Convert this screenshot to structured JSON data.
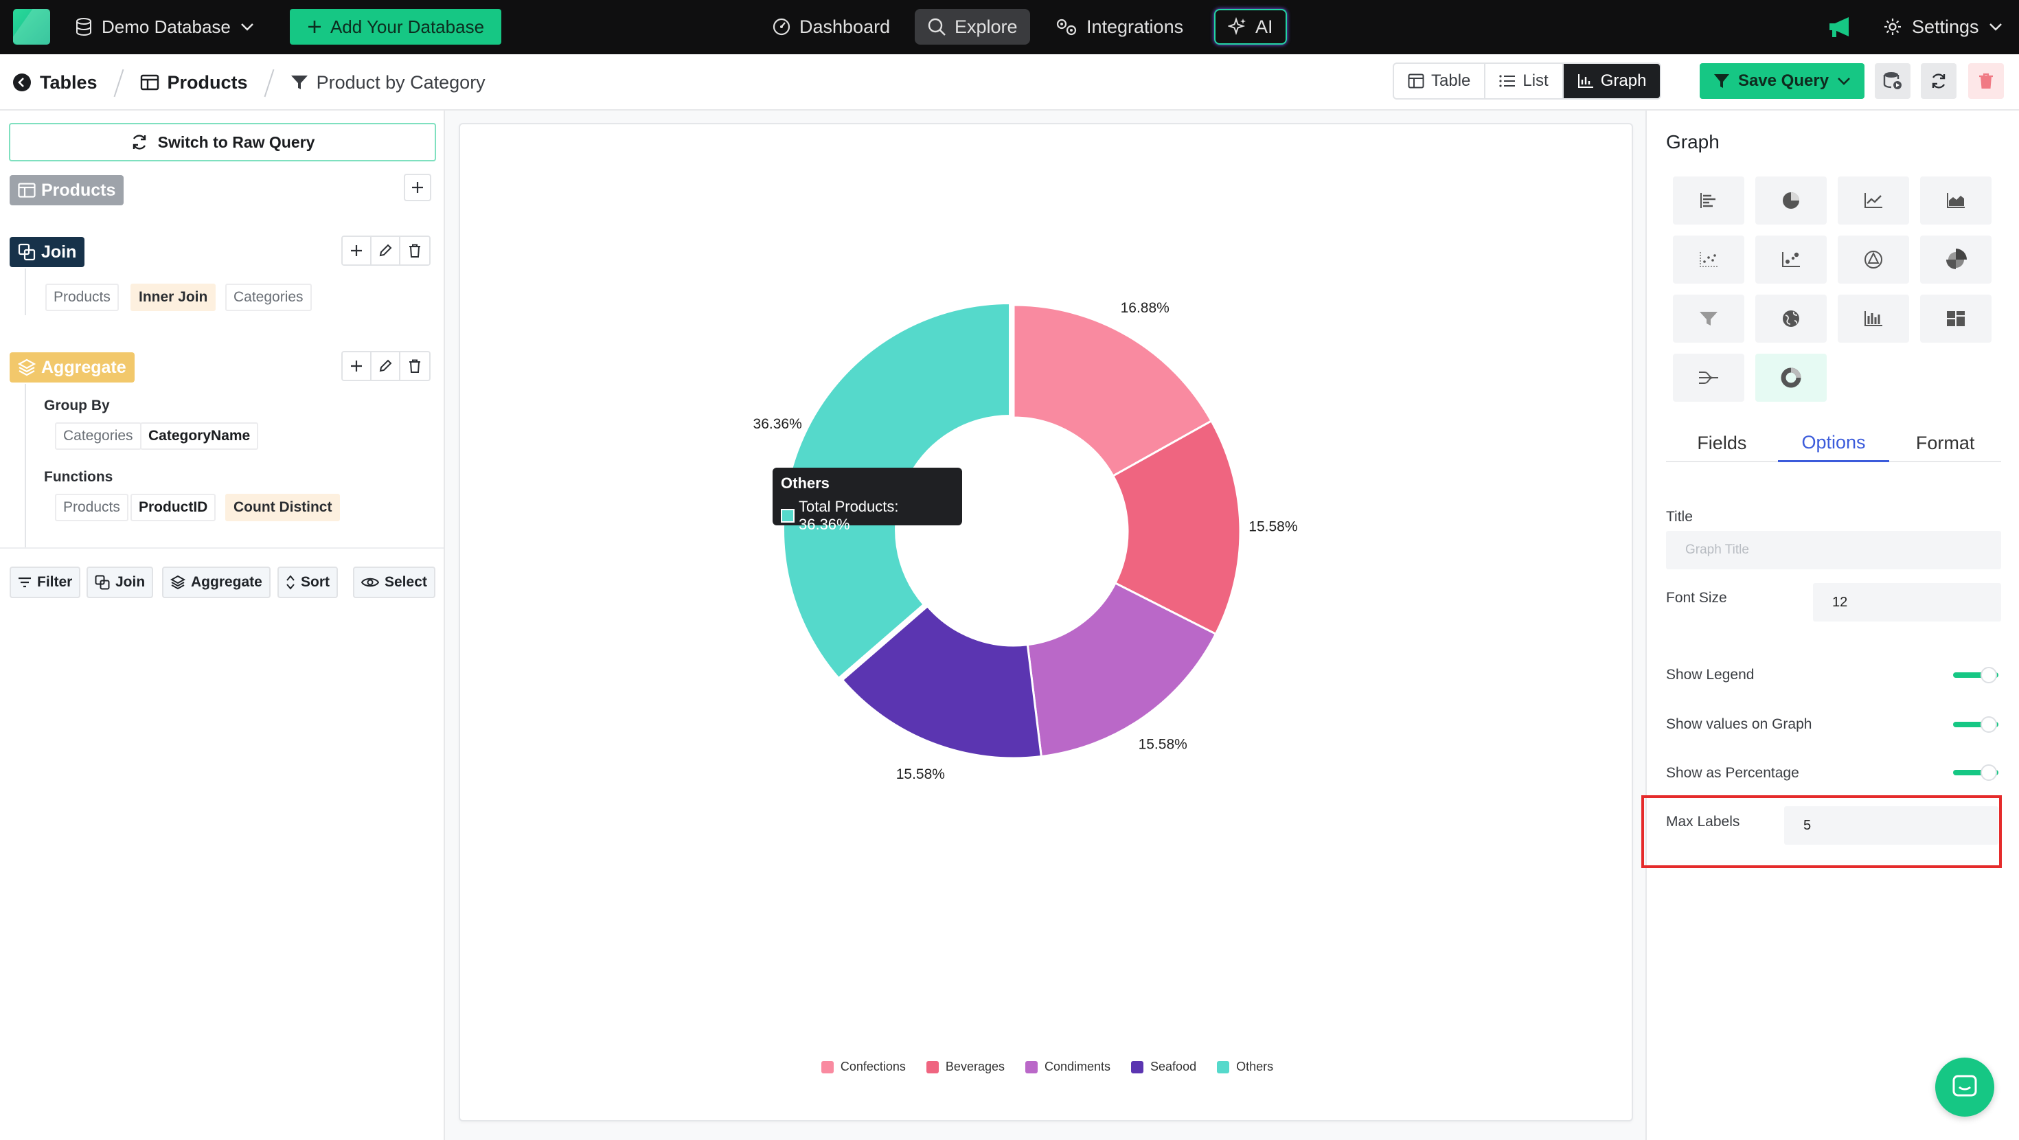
{
  "topnav": {
    "database_label": "Demo Database",
    "add_database_label": "Add Your Database",
    "dashboard_label": "Dashboard",
    "explore_label": "Explore",
    "integrations_label": "Integrations",
    "ai_label": "AI",
    "settings_label": "Settings"
  },
  "breadcrumb": {
    "tables": "Tables",
    "products": "Products",
    "query": "Product by Category"
  },
  "view_toggle": {
    "table": "Table",
    "list": "List",
    "graph": "Graph",
    "active": "Graph"
  },
  "toolbar": {
    "save_query_label": "Save Query"
  },
  "left_panel": {
    "switch_raw_label": "Switch to Raw Query",
    "source_table": "Products",
    "join": {
      "label": "Join",
      "left": "Products",
      "type": "Inner Join",
      "right": "Categories"
    },
    "aggregate": {
      "label": "Aggregate",
      "group_by_label": "Group By",
      "group_by_table": "Categories",
      "group_by_field": "CategoryName",
      "functions_label": "Functions",
      "func_table": "Products",
      "func_field": "ProductID",
      "func_name": "Count Distinct"
    },
    "actions": {
      "filter": "Filter",
      "join": "Join",
      "aggregate": "Aggregate",
      "sort": "Sort",
      "select": "Select"
    }
  },
  "chart_data": {
    "type": "pie",
    "variant": "donut",
    "title": "",
    "categories": [
      "Confections",
      "Beverages",
      "Condiments",
      "Seafood",
      "Others"
    ],
    "values": [
      16.88,
      15.58,
      15.58,
      15.58,
      36.36
    ],
    "value_labels": [
      "16.88%",
      "15.58%",
      "15.58%",
      "15.58%",
      "36.36%"
    ],
    "colors": [
      "#f98aa0",
      "#ef6580",
      "#ba68c8",
      "#5b35b1",
      "#55d9cb"
    ],
    "legend": "bottom-center",
    "highlighted_slice": "Others"
  },
  "tooltip": {
    "title": "Others",
    "row": "Total Products: 36.36%"
  },
  "right_panel": {
    "title": "Graph",
    "chart_type_icons": [
      "bar-chart-icon",
      "pie-chart-icon",
      "line-chart-icon",
      "area-chart-icon",
      "scatter-chart-icon",
      "bubble-chart-icon",
      "radar-chart-icon",
      "polar-area-icon",
      "funnel-chart-icon",
      "map-chart-icon",
      "histogram-icon",
      "treemap-icon",
      "sankey-chart-icon",
      "donut-chart-icon"
    ],
    "active_chart_type": "donut-chart-icon",
    "tabs": [
      "Fields",
      "Options",
      "Format"
    ],
    "active_tab": "Options",
    "options": {
      "title_label": "Title",
      "title_placeholder": "Graph Title",
      "font_size_label": "Font Size",
      "font_size_value": "12",
      "show_legend_label": "Show Legend",
      "show_legend": true,
      "show_values_label": "Show values on Graph",
      "show_values": true,
      "show_percentage_label": "Show as Percentage",
      "show_percentage": true,
      "max_labels_label": "Max Labels",
      "max_labels_value": "5"
    }
  },
  "colors": {
    "accent": "#16c784",
    "tab_active": "#3b5bdb",
    "highlight_box": "#e52b2b"
  }
}
